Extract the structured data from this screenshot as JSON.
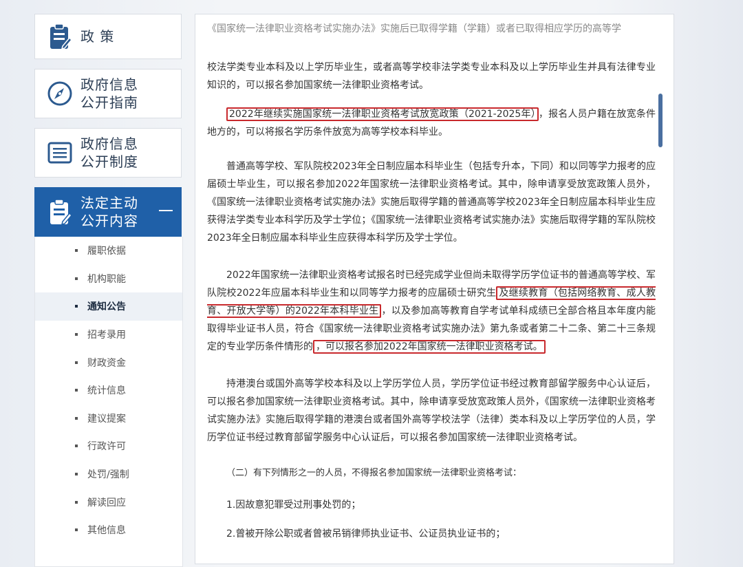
{
  "sidebar": {
    "cards": [
      {
        "label": "政    策",
        "icon": "clipboard-icon"
      },
      {
        "label": "政府信息\n公开指南",
        "icon": "compass-icon"
      },
      {
        "label": "政府信息\n公开制度",
        "icon": "document-list-icon"
      },
      {
        "label": "法定主动\n公开内容",
        "icon": "clipboard-edit-icon"
      }
    ],
    "sub_items": [
      "履职依据",
      "机构职能",
      "通知公告",
      "招考录用",
      "财政资金",
      "统计信息",
      "建议提案",
      "行政许可",
      "处罚/强制",
      "解读回应",
      "其他信息"
    ],
    "active_sub_index": 2,
    "active_color": "#1f60a8"
  },
  "article": {
    "p0_top": "《国家统一法律职业资格考试实施办法》实施后已取得学籍（学籍）或者已取得相应学历的高等学",
    "p0": "校法学类专业本科及以上学历毕业生，或者高等学校非法学类专业本科及以上学历毕业生并具有法律专业知识的，可以报名参加国家统一法律职业资格考试。",
    "p1_hl": "2022年继续实施国家统一法律职业资格考试放宽政策（2021-2025年）",
    "p1_rest": "，报名人员户籍在放宽条件地方的，可以将报名学历条件放宽为高等学校本科毕业。",
    "p2": "普通高等学校、军队院校2023年全日制应届本科毕业生（包括专升本，下同）和以同等学力报考的应届硕士毕业生，可以报名参加2022年国家统一法律职业资格考试。其中，除申请享受放宽政策人员外，《国家统一法律职业资格考试实施办法》实施后取得学籍的普通高等学校2023年全日制应届本科毕业生应获得法学类专业本科学历及学士学位；《国家统一法律职业资格考试实施办法》实施后取得学籍的军队院校2023年全日制应届本科毕业生应获得本科学历及学士学位。",
    "p3_a": "2022年国家统一法律职业资格考试报名时已经完成学业但尚未取得学历学位证书的普通高等学校、军队院校2022年应届本科毕业生和以同等学力报考的应届硕士研究生",
    "p3_hl1": "及继续教育（包括网络教育、成人教育、开放大学等）的2022年本科毕业生",
    "p3_b": "，以及参加高等教育自学考试单科成绩已全部合格且本年度内能取得毕业证书人员，符合《国家统一法律职业资格考试实施办法》第九条或者第二十二条、第二十三条规定的专业学历条件情形的",
    "p3_hl2": "，可以报名参加2022年国家统一法律职业资格考试。",
    "p4": "持港澳台或国外高等学校本科及以上学历学位人员，学历学位证书经过教育部留学服务中心认证后，可以报名参加国家统一法律职业资格考试。其中，除申请享受放宽政策人员外，《国家统一法律职业资格考试实施办法》实施后取得学籍的港澳台或者国外高等学校法学（法律）类本科及以上学历学位的人员，学历学位证书经过教育部留学服务中心认证后，可以报名参加国家统一法律职业资格考试。",
    "p5": "（二）有下列情形之一的人员，不得报名参加国家统一法律职业资格考试：",
    "p6": "1.因故意犯罪受过刑事处罚的；",
    "p7": "2.曾被开除公职或者曾被吊销律师执业证书、公证员执业证书的；",
    "highlight_color": "#c8282c"
  }
}
